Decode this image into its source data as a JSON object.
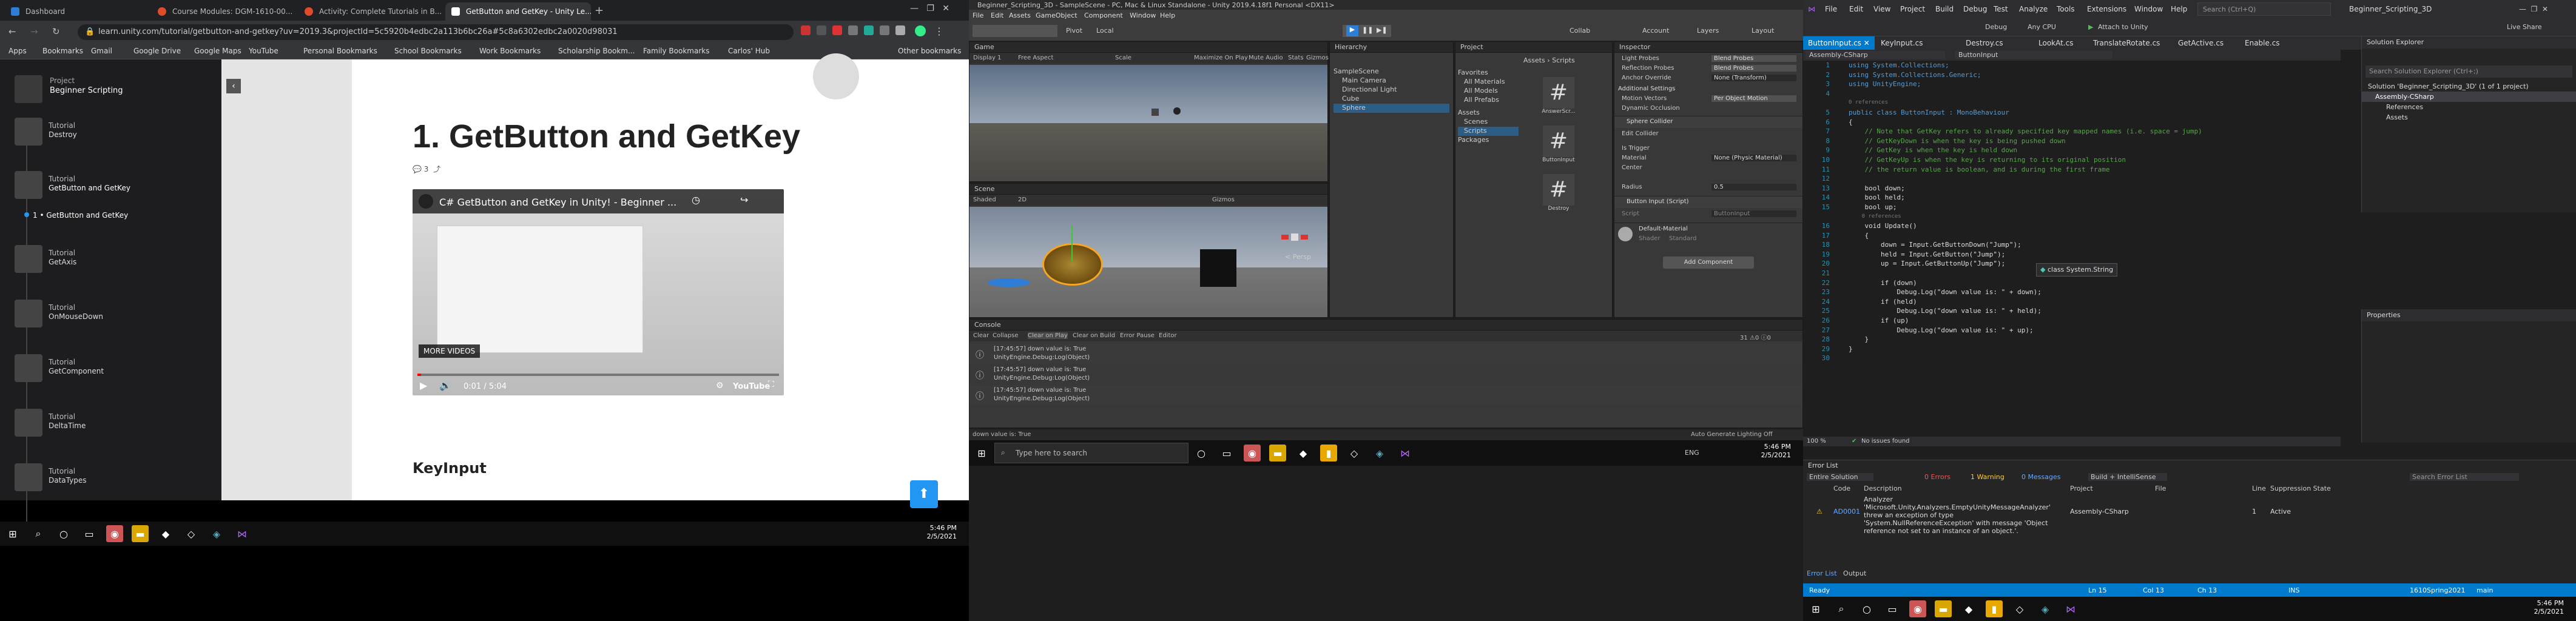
{
  "chrome": {
    "tabs": [
      "Dashboard",
      "Course Modules: DGM-1610-00...",
      "Activity: Complete Tutorials in B...",
      "GetButton and GetKey - Unity Le..."
    ],
    "url": "learn.unity.com/tutorial/getbutton-and-getkey?uv=2019.3&projectId=5c5920b4edbc2a113b6bc26a#5c8a6302edbc2a0020d98031",
    "bookmarks": [
      "Apps",
      "Bookmarks",
      "Gmail",
      "Google Drive",
      "Google Maps",
      "YouTube",
      "Personal Bookmarks",
      "School Bookmarks",
      "Work Bookmarks",
      "Scholarship Bookm...",
      "Family Bookmarks",
      "Carlos' Hub",
      "Other bookmarks"
    ]
  },
  "learn": {
    "project_label": "Project",
    "project_name": "Beginner Scripting",
    "sidebar": [
      {
        "kicker": "Tutorial",
        "title": "Destroy"
      },
      {
        "kicker": "Tutorial",
        "title": "GetButton and GetKey"
      },
      {
        "kicker": "",
        "title": "1 • GetButton and GetKey"
      },
      {
        "kicker": "Tutorial",
        "title": "GetAxis"
      },
      {
        "kicker": "Tutorial",
        "title": "OnMouseDown"
      },
      {
        "kicker": "Tutorial",
        "title": "GetComponent"
      },
      {
        "kicker": "Tutorial",
        "title": "DeltaTime"
      },
      {
        "kicker": "Tutorial",
        "title": "DataTypes"
      }
    ],
    "heading": "1. GetButton and GetKey",
    "comment_count": "3",
    "video_title": "C# GetButton and GetKey in Unity! - Beginner ...",
    "more_videos": "MORE VIDEOS",
    "video_time": "0:01 / 5:04",
    "youtube": "YouTube",
    "subheading": "KeyInput"
  },
  "taskbar": {
    "time": "5:46 PM",
    "date": "2/5/2021",
    "search_placeholder": "Type here to search",
    "lang": "ENG"
  },
  "unity": {
    "title": "Beginner_Scripting_3D - SampleScene - PC, Mac & Linux Standalone - Unity 2019.4.18f1 Personal <DX11>",
    "menu": [
      "File",
      "Edit",
      "Assets",
      "GameObject",
      "Component",
      "Window",
      "Help"
    ],
    "toolbar": {
      "pivot": "Pivot",
      "local": "Local",
      "collab": "Collab",
      "account": "Account",
      "layers": "Layers",
      "layout": "Layout"
    },
    "game_tab": "Game",
    "game_display": "Display 1",
    "game_aspect": "Free Aspect",
    "game_scale": "Scale",
    "game_opts": [
      "Maximize On Play",
      "Mute Audio",
      "Stats",
      "Gizmos"
    ],
    "scene_tab": "Scene",
    "scene_shading": "Shaded",
    "scene_2d": "2D",
    "scene_gizmos": "Gizmos",
    "scene_persp": "< Persp",
    "hierarchy_tab": "Hierarchy",
    "hierarchy": [
      "SampleScene",
      "Main Camera",
      "Directional Light",
      "Cube",
      "Sphere"
    ],
    "project_tab": "Project",
    "project_tree": [
      "Favorites",
      "All Materials",
      "All Models",
      "All Prefabs",
      "Assets",
      "Scenes",
      "Scripts",
      "Packages"
    ],
    "project_assets": [
      "Assets",
      "Scripts"
    ],
    "project_files": [
      "AnswerScr...",
      "ButtonInput",
      "Destroy"
    ],
    "inspector_tab": "Inspector",
    "inspector": {
      "light_probes": "Light Probes",
      "light_probes_val": "Blend Probes",
      "reflection_probes": "Reflection Probes",
      "reflection_probes_val": "Blend Probes",
      "anchor_override": "Anchor Override",
      "anchor_override_val": "None (Transform)",
      "additional": "Additional Settings",
      "motion_vectors": "Motion Vectors",
      "motion_vectors_val": "Per Object Motion",
      "dyn_occlusion": "Dynamic Occlusion",
      "collider": "Sphere Collider",
      "edit_collider": "Edit Collider",
      "is_trigger": "Is Trigger",
      "material": "Material",
      "material_val": "None (Physic Material)",
      "center": "Center",
      "radius": "Radius",
      "radius_val": "0.5",
      "script": "Button Input (Script)",
      "script_label": "Script",
      "script_val": "ButtonInput",
      "mat_name": "Default-Material",
      "shader": "Shader",
      "shader_val": "Standard",
      "add_component": "Add Component"
    },
    "console_tab": "Console",
    "console_btns": [
      "Clear",
      "Collapse",
      "Clear on Play",
      "Clear on Build",
      "Error Pause",
      "Editor"
    ],
    "console": [
      {
        "time": "[17:45:57] down value is: True",
        "sub": "UnityEngine.Debug:Log(Object)"
      },
      {
        "time": "[17:45:57] down value is: True",
        "sub": "UnityEngine.Debug:Log(Object)"
      },
      {
        "time": "[17:45:57] down value is: True",
        "sub": "UnityEngine.Debug:Log(Object)"
      }
    ],
    "status": "down value is: True",
    "status_right": "Auto Generate Lighting Off",
    "counts": [
      "31",
      "0",
      "0"
    ]
  },
  "vs": {
    "menu": [
      "File",
      "Edit",
      "View",
      "Project",
      "Build",
      "Debug",
      "Test",
      "Analyze",
      "Tools",
      "Extensions",
      "Window",
      "Help"
    ],
    "search": "Search (Ctrl+Q)",
    "solution_title": "Beginner_Scripting_3D",
    "toolbar": {
      "debug": "Debug",
      "cpu": "Any CPU",
      "attach": "Attach to Unity",
      "live_share": "Live Share"
    },
    "tabs": [
      "ButtonInput.cs",
      "KeyInput.cs",
      "Destroy.cs",
      "LookAt.cs",
      "TranslateRotate.cs",
      "GetActive.cs",
      "Enable.cs"
    ],
    "nav_left": "Assembly-CSharp",
    "nav_right": "ButtonInput",
    "code": [
      {
        "n": "1",
        "t": "using System.Collections;",
        "c": "kw"
      },
      {
        "n": "2",
        "t": "using System.Collections.Generic;",
        "c": "kw"
      },
      {
        "n": "3",
        "t": "using UnityEngine;",
        "c": "kw"
      },
      {
        "n": "4",
        "t": "",
        "c": ""
      },
      {
        "n": "",
        "t": "0 references",
        "c": "ln"
      },
      {
        "n": "5",
        "t": "public class ButtonInput : MonoBehaviour",
        "c": "kw"
      },
      {
        "n": "6",
        "t": "{",
        "c": ""
      },
      {
        "n": "7",
        "t": "    // Note that GetKey refers to already specified key mapped names (i.e. space = jump)",
        "c": "cm"
      },
      {
        "n": "8",
        "t": "    // GetKeyDown is when the key is being pushed down",
        "c": "cm"
      },
      {
        "n": "9",
        "t": "    // GetKey is when the key is held down",
        "c": "cm"
      },
      {
        "n": "10",
        "t": "    // GetKeyUp is when the key is returning to its original position",
        "c": "cm"
      },
      {
        "n": "11",
        "t": "    // the return value is boolean, and is during the first frame",
        "c": "cm"
      },
      {
        "n": "12",
        "t": "",
        "c": ""
      },
      {
        "n": "13",
        "t": "    bool down;",
        "c": ""
      },
      {
        "n": "14",
        "t": "    bool held;",
        "c": ""
      },
      {
        "n": "15",
        "t": "    bool up;",
        "c": ""
      },
      {
        "n": "",
        "t": "    0 references",
        "c": "ln"
      },
      {
        "n": "16",
        "t": "    void Update()",
        "c": ""
      },
      {
        "n": "17",
        "t": "    {",
        "c": ""
      },
      {
        "n": "18",
        "t": "        down = Input.GetButtonDown(\"Jump\");",
        "c": ""
      },
      {
        "n": "19",
        "t": "        held = Input.GetButton(\"Jump\");",
        "c": ""
      },
      {
        "n": "20",
        "t": "        up = Input.GetButtonUp(\"Jump\");",
        "c": ""
      },
      {
        "n": "21",
        "t": "",
        "c": ""
      },
      {
        "n": "22",
        "t": "        if (down)",
        "c": ""
      },
      {
        "n": "23",
        "t": "            Debug.Log(\"down value is: \" + down);",
        "c": ""
      },
      {
        "n": "24",
        "t": "        if (held)",
        "c": ""
      },
      {
        "n": "25",
        "t": "            Debug.Log(\"down value is: \" + held);",
        "c": ""
      },
      {
        "n": "26",
        "t": "        if (up)",
        "c": ""
      },
      {
        "n": "27",
        "t": "            Debug.Log(\"down value is: \" + up);",
        "c": ""
      },
      {
        "n": "28",
        "t": "    }",
        "c": ""
      },
      {
        "n": "29",
        "t": "}",
        "c": ""
      },
      {
        "n": "30",
        "t": "",
        "c": ""
      }
    ],
    "tooltip": "class System.String",
    "zoom": "100 %",
    "no_issues": "No issues found",
    "ln": "Ln 15",
    "col": "Col 13",
    "ch": "Ch 13",
    "ins": "INS",
    "solution_explorer": "Solution Explorer",
    "search_solution": "Search Solution Explorer (Ctrl+;)",
    "solution_items": [
      "Solution 'Beginner_Scripting_3D' (1 of 1 project)",
      "Assembly-CSharp",
      "References",
      "Assets"
    ],
    "properties": "Properties",
    "error_list": {
      "title": "Error List",
      "scope": "Entire Solution",
      "errors": "0 Errors",
      "warnings": "1 Warning",
      "messages": "0 Messages",
      "build": "Build + IntelliSense",
      "search": "Search Error List",
      "cols": [
        "Code",
        "Description",
        "Project",
        "File",
        "Line",
        "Suppression State"
      ],
      "row": {
        "code": "AD0001",
        "desc": "Analyzer 'Microsoft.Unity.Analyzers.EmptyUnityMessageAnalyzer' threw an exception of type 'System.NullReferenceException' with message 'Object reference not set to an instance of an object.'.",
        "project": "Assembly-CSharp",
        "line": "1",
        "state": "Active"
      },
      "tabs": [
        "Error List",
        "Output"
      ]
    },
    "status": {
      "ready": "Ready",
      "git": "1610Spring2021",
      "branch": "main"
    }
  }
}
